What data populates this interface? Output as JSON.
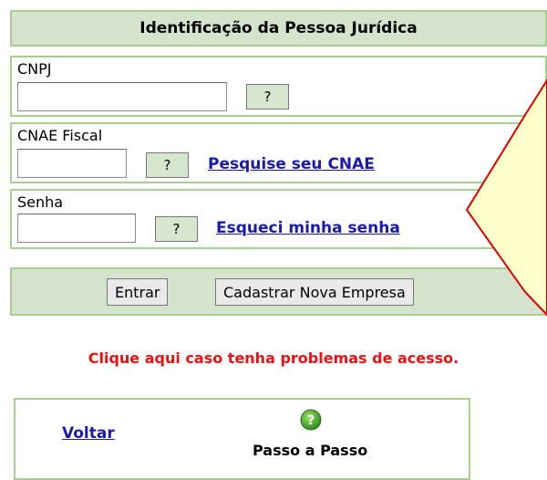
{
  "header": {
    "title": "Identificação da Pessoa Jurídica"
  },
  "cnpj": {
    "label": "CNPJ",
    "value": "",
    "help_label": "?"
  },
  "cnae": {
    "label": "CNAE Fiscal",
    "value": "",
    "help_label": "?",
    "link": "Pesquise seu CNAE"
  },
  "senha": {
    "label": "Senha",
    "value": "",
    "help_label": "?",
    "link": "Esqueci minha senha"
  },
  "actions": {
    "enter_label": "Entrar",
    "register_label": "Cadastrar Nova Empresa"
  },
  "access_problem": "Clique aqui caso tenha problemas de acesso.",
  "footer": {
    "back_link": "Voltar",
    "help_icon": "question-icon",
    "step_label": "Passo a Passo"
  },
  "colors": {
    "panel_bg": "#d6e3cc",
    "panel_border": "#a7cf8d",
    "link": "#1a1ab0",
    "alert": "#ee1111",
    "callout_fill": "#ffffcc",
    "callout_border": "#e00000"
  }
}
